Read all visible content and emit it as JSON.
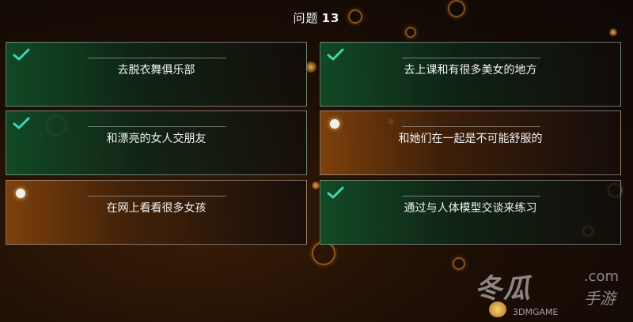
{
  "question": {
    "prefix": "问题",
    "number": "13"
  },
  "answers": [
    {
      "label": "去脱衣舞俱乐部",
      "state": "checked",
      "icon": "checkmark-icon"
    },
    {
      "label": "去上课和有很多美女的地方",
      "state": "checked",
      "icon": "checkmark-icon"
    },
    {
      "label": "和漂亮的女人交朋友",
      "state": "checked",
      "icon": "checkmark-icon"
    },
    {
      "label": "和她们在一起是不可能舒服的",
      "state": "unchecked",
      "icon": "radio-dot-icon"
    },
    {
      "label": "在网上看看很多女孩",
      "state": "active",
      "icon": "radio-dot-icon"
    },
    {
      "label": "通过与人体模型交谈来练习",
      "state": "checked",
      "icon": "checkmark-icon"
    }
  ],
  "colors": {
    "check": "#3fd6b4",
    "checked_bg": "#104e28",
    "active_bg": "#8c480c",
    "border": "#bebebe"
  },
  "watermark": {
    "site_cn": "冬瓜",
    "domain": ".com",
    "tagline_cn": "手游",
    "brand": "3DMGAME"
  }
}
